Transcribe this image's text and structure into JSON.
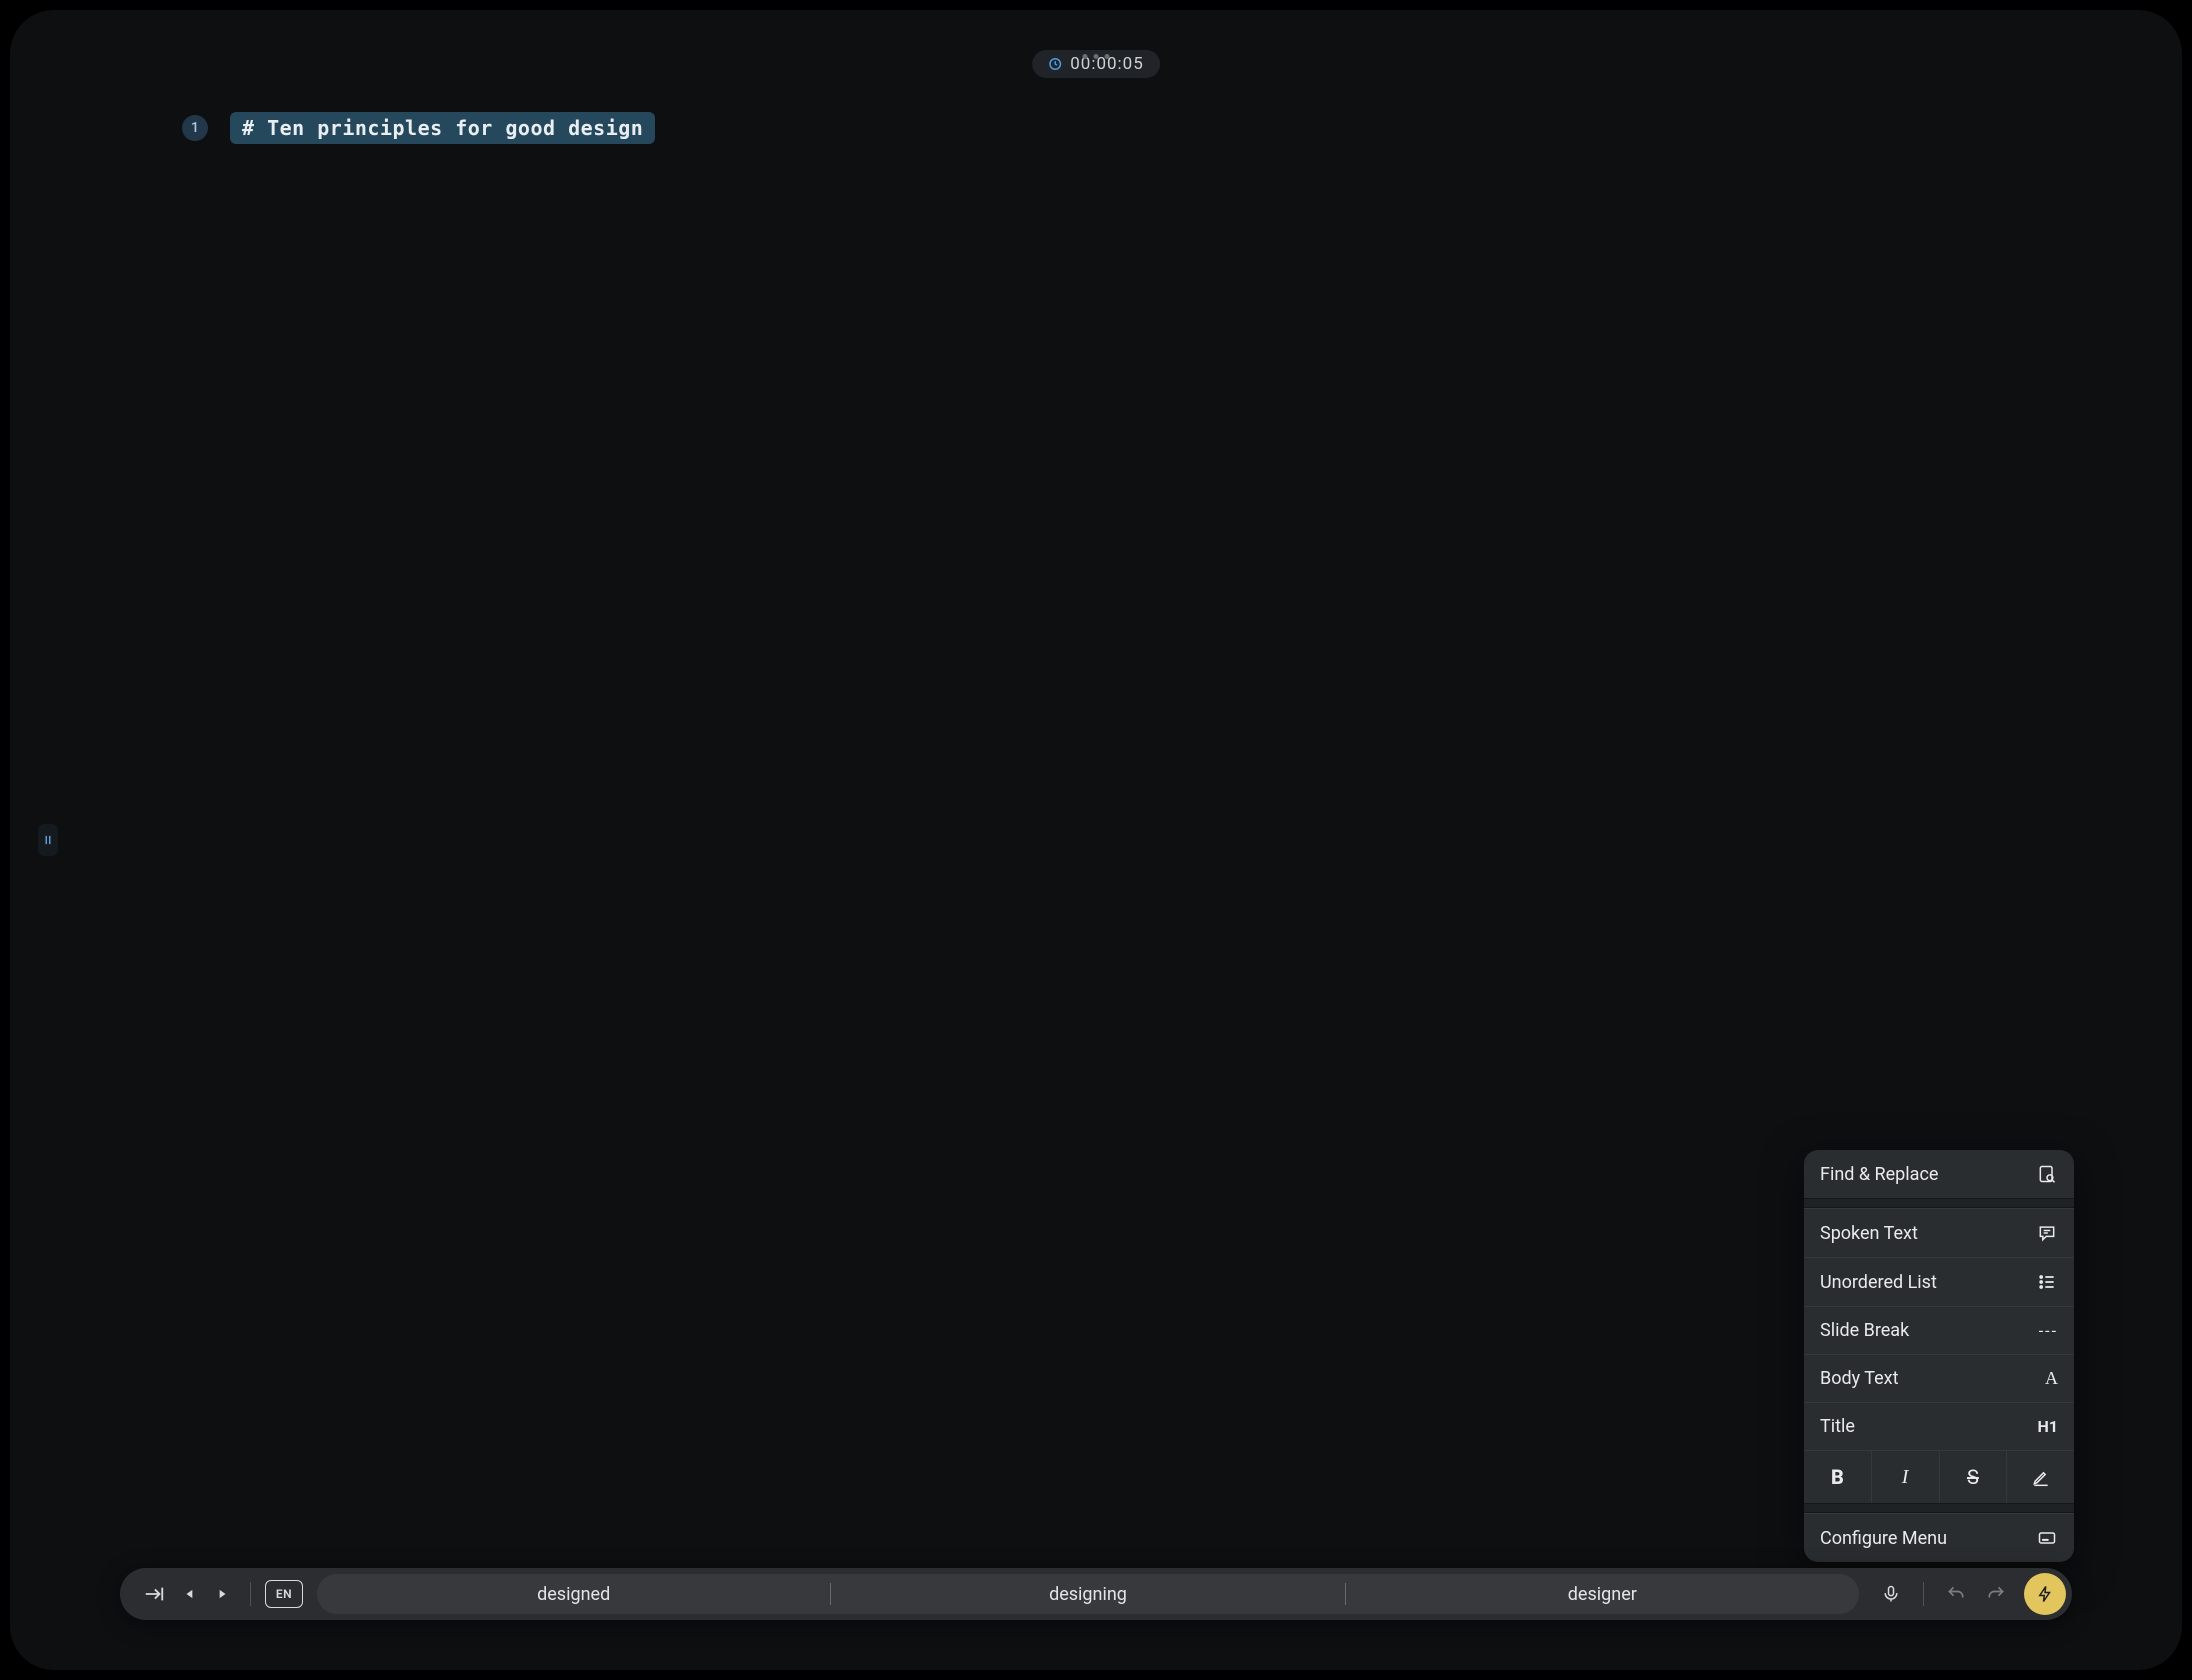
{
  "timer": {
    "elapsed": "00:00:05"
  },
  "editor": {
    "line_number": "1",
    "line_text": "# Ten principles for good design"
  },
  "popover": {
    "find_replace": "Find & Replace",
    "spoken_text": "Spoken Text",
    "unordered_list": "Unordered List",
    "slide_break": "Slide Break",
    "slide_break_badge": "---",
    "body_text": "Body Text",
    "body_text_badge": "A",
    "title": "Title",
    "title_badge": "H1",
    "configure_menu": "Configure Menu"
  },
  "keyboard_bar": {
    "language": "EN",
    "suggestions": [
      "designed",
      "designing",
      "designer"
    ]
  }
}
